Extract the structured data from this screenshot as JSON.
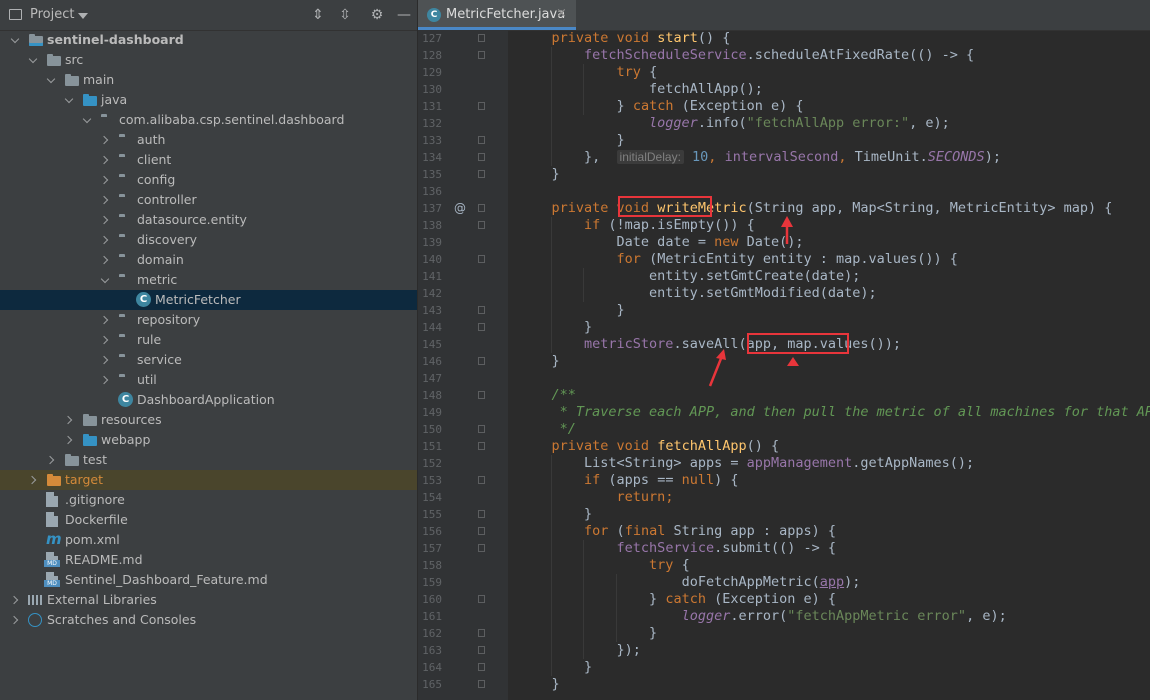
{
  "project_panel": {
    "title": "Project",
    "tree": [
      {
        "label": "sentinel-dashboard",
        "level": 0,
        "arrow": "exp",
        "icon": "folder-module",
        "bold": true
      },
      {
        "label": "src",
        "level": 1,
        "arrow": "exp",
        "icon": "folder"
      },
      {
        "label": "main",
        "level": 2,
        "arrow": "exp",
        "icon": "folder"
      },
      {
        "label": "java",
        "level": 3,
        "arrow": "exp",
        "icon": "folder-blue"
      },
      {
        "label": "com.alibaba.csp.sentinel.dashboard",
        "level": 4,
        "arrow": "exp",
        "icon": "package"
      },
      {
        "label": "auth",
        "level": 5,
        "arrow": "col",
        "icon": "package"
      },
      {
        "label": "client",
        "level": 5,
        "arrow": "col",
        "icon": "package"
      },
      {
        "label": "config",
        "level": 5,
        "arrow": "col",
        "icon": "package"
      },
      {
        "label": "controller",
        "level": 5,
        "arrow": "col",
        "icon": "package"
      },
      {
        "label": "datasource.entity",
        "level": 5,
        "arrow": "col",
        "icon": "package"
      },
      {
        "label": "discovery",
        "level": 5,
        "arrow": "col",
        "icon": "package"
      },
      {
        "label": "domain",
        "level": 5,
        "arrow": "col",
        "icon": "package"
      },
      {
        "label": "metric",
        "level": 5,
        "arrow": "exp",
        "icon": "package"
      },
      {
        "label": "MetricFetcher",
        "level": 6,
        "arrow": "",
        "icon": "class",
        "selected": true
      },
      {
        "label": "repository",
        "level": 5,
        "arrow": "col",
        "icon": "package"
      },
      {
        "label": "rule",
        "level": 5,
        "arrow": "col",
        "icon": "package"
      },
      {
        "label": "service",
        "level": 5,
        "arrow": "col",
        "icon": "package"
      },
      {
        "label": "util",
        "level": 5,
        "arrow": "col",
        "icon": "package"
      },
      {
        "label": "DashboardApplication",
        "level": 5,
        "arrow": "",
        "icon": "class"
      },
      {
        "label": "resources",
        "level": 3,
        "arrow": "col",
        "icon": "folder"
      },
      {
        "label": "webapp",
        "level": 3,
        "arrow": "col",
        "icon": "folder-blue"
      },
      {
        "label": "test",
        "level": 2,
        "arrow": "col",
        "icon": "folder"
      },
      {
        "label": "target",
        "level": 1,
        "arrow": "col",
        "icon": "folder-orange",
        "target": true
      },
      {
        "label": ".gitignore",
        "level": 1,
        "arrow": "",
        "icon": "file"
      },
      {
        "label": "Dockerfile",
        "level": 1,
        "arrow": "",
        "icon": "file"
      },
      {
        "label": "pom.xml",
        "level": 1,
        "arrow": "",
        "icon": "maven"
      },
      {
        "label": "README.md",
        "level": 1,
        "arrow": "",
        "icon": "md"
      },
      {
        "label": "Sentinel_Dashboard_Feature.md",
        "level": 1,
        "arrow": "",
        "icon": "md"
      },
      {
        "label": "External Libraries",
        "level": 0,
        "arrow": "col",
        "icon": "library"
      },
      {
        "label": "Scratches and Consoles",
        "level": 0,
        "arrow": "col",
        "icon": "scratch"
      }
    ]
  },
  "editor": {
    "tab": {
      "label": "MetricFetcher.java",
      "close": "×"
    },
    "lines": [
      {
        "n": "127",
        "indent": 4,
        "toks": [
          [
            "kw",
            "private void "
          ],
          [
            "fn",
            "start"
          ],
          [
            "",
            "() {"
          ]
        ]
      },
      {
        "n": "128",
        "indent": 8,
        "toks": [
          [
            "fld",
            "fetchScheduleService"
          ],
          [
            "",
            ".scheduleAtFixedRate(() -> {"
          ]
        ]
      },
      {
        "n": "129",
        "indent": 12,
        "toks": [
          [
            "kw",
            "try"
          ],
          [
            "",
            " {"
          ]
        ]
      },
      {
        "n": "130",
        "indent": 16,
        "toks": [
          [
            "",
            "fetchAllApp();"
          ]
        ]
      },
      {
        "n": "131",
        "indent": 12,
        "toks": [
          [
            "",
            "} "
          ],
          [
            "kw",
            "catch"
          ],
          [
            "",
            " (Exception e) {"
          ]
        ]
      },
      {
        "n": "132",
        "indent": 16,
        "toks": [
          [
            "fld it",
            "logger"
          ],
          [
            "",
            ".info("
          ],
          [
            "str",
            "\"fetchAllApp error:\""
          ],
          [
            "",
            ", e);"
          ]
        ]
      },
      {
        "n": "133",
        "indent": 12,
        "toks": [
          [
            "",
            "}"
          ]
        ]
      },
      {
        "n": "134",
        "indent": 8,
        "toks": [
          [
            "",
            "},  "
          ],
          [
            "hint",
            "initialDelay:"
          ],
          [
            "num",
            " 10"
          ],
          [
            "kw",
            ", "
          ],
          [
            "fld",
            "intervalSecond"
          ],
          [
            "kw",
            ", "
          ],
          [
            "",
            "TimeUnit."
          ],
          [
            "fld it",
            "SECONDS"
          ],
          [
            "",
            ");"
          ]
        ]
      },
      {
        "n": "135",
        "indent": 4,
        "toks": [
          [
            "",
            "}"
          ]
        ]
      },
      {
        "n": "136",
        "indent": 0,
        "toks": []
      },
      {
        "n": "137",
        "indent": 4,
        "toks": [
          [
            "kw",
            "private void "
          ],
          [
            "fn",
            "writeMetric"
          ],
          [
            "",
            "(String app, Map<String, MetricEntity> map) {"
          ]
        ]
      },
      {
        "n": "138",
        "indent": 8,
        "toks": [
          [
            "kw",
            "if"
          ],
          [
            "",
            " (!map.isEmpty()) {"
          ]
        ]
      },
      {
        "n": "139",
        "indent": 12,
        "toks": [
          [
            "",
            "Date date = "
          ],
          [
            "kw",
            "new "
          ],
          [
            "",
            "Date();"
          ]
        ]
      },
      {
        "n": "140",
        "indent": 12,
        "toks": [
          [
            "kw",
            "for"
          ],
          [
            "",
            " (MetricEntity entity : map.values()) {"
          ]
        ]
      },
      {
        "n": "141",
        "indent": 16,
        "toks": [
          [
            "",
            "entity.setGmtCreate(date);"
          ]
        ]
      },
      {
        "n": "142",
        "indent": 16,
        "toks": [
          [
            "",
            "entity.setGmtModified(date);"
          ]
        ]
      },
      {
        "n": "143",
        "indent": 12,
        "toks": [
          [
            "",
            "}"
          ]
        ]
      },
      {
        "n": "144",
        "indent": 8,
        "toks": [
          [
            "",
            "}"
          ]
        ]
      },
      {
        "n": "145",
        "indent": 8,
        "toks": [
          [
            "fld",
            "metricStore"
          ],
          [
            "",
            ".saveAll(app, map.values());"
          ]
        ]
      },
      {
        "n": "146",
        "indent": 4,
        "toks": [
          [
            "",
            "}"
          ]
        ]
      },
      {
        "n": "147",
        "indent": 0,
        "toks": []
      },
      {
        "n": "148",
        "indent": 4,
        "toks": [
          [
            "cm",
            "/**"
          ]
        ]
      },
      {
        "n": "149",
        "indent": 4,
        "toks": [
          [
            "cm",
            " * Traverse each APP, and then pull the metric of all machines for that APP."
          ]
        ]
      },
      {
        "n": "150",
        "indent": 4,
        "toks": [
          [
            "cm",
            " */"
          ]
        ]
      },
      {
        "n": "151",
        "indent": 4,
        "toks": [
          [
            "kw",
            "private void "
          ],
          [
            "fn",
            "fetchAllApp"
          ],
          [
            "",
            "() {"
          ]
        ]
      },
      {
        "n": "152",
        "indent": 8,
        "toks": [
          [
            "",
            "List<String> apps = "
          ],
          [
            "fld",
            "appManagement"
          ],
          [
            "",
            ".getAppNames();"
          ]
        ]
      },
      {
        "n": "153",
        "indent": 8,
        "toks": [
          [
            "kw",
            "if"
          ],
          [
            "",
            " (apps == "
          ],
          [
            "kw",
            "null"
          ],
          [
            "",
            ") {"
          ]
        ]
      },
      {
        "n": "154",
        "indent": 12,
        "toks": [
          [
            "kw",
            "return;"
          ]
        ]
      },
      {
        "n": "155",
        "indent": 8,
        "toks": [
          [
            "",
            "}"
          ]
        ]
      },
      {
        "n": "156",
        "indent": 8,
        "toks": [
          [
            "kw",
            "for"
          ],
          [
            "",
            " ("
          ],
          [
            "kw",
            "final "
          ],
          [
            "",
            "String app : apps) {"
          ]
        ]
      },
      {
        "n": "157",
        "indent": 12,
        "toks": [
          [
            "fld",
            "fetchService"
          ],
          [
            "",
            ".submit(() -> {"
          ]
        ]
      },
      {
        "n": "158",
        "indent": 16,
        "toks": [
          [
            "kw",
            "try"
          ],
          [
            "",
            " {"
          ]
        ]
      },
      {
        "n": "159",
        "indent": 20,
        "toks": [
          [
            "",
            "doFetchAppMetric("
          ],
          [
            "fld ul",
            "app"
          ],
          [
            "",
            ");"
          ]
        ]
      },
      {
        "n": "160",
        "indent": 16,
        "toks": [
          [
            "",
            "} "
          ],
          [
            "kw",
            "catch"
          ],
          [
            "",
            " (Exception e) {"
          ]
        ]
      },
      {
        "n": "161",
        "indent": 20,
        "toks": [
          [
            "fld it",
            "logger"
          ],
          [
            "",
            ".error("
          ],
          [
            "str",
            "\"fetchAppMetric error\""
          ],
          [
            "",
            ", e);"
          ]
        ]
      },
      {
        "n": "162",
        "indent": 16,
        "toks": [
          [
            "",
            "}"
          ]
        ]
      },
      {
        "n": "163",
        "indent": 12,
        "toks": [
          [
            "",
            "});"
          ]
        ]
      },
      {
        "n": "164",
        "indent": 8,
        "toks": [
          [
            "",
            "}"
          ]
        ]
      },
      {
        "n": "165",
        "indent": 4,
        "toks": [
          [
            "",
            "}"
          ]
        ]
      }
    ]
  }
}
